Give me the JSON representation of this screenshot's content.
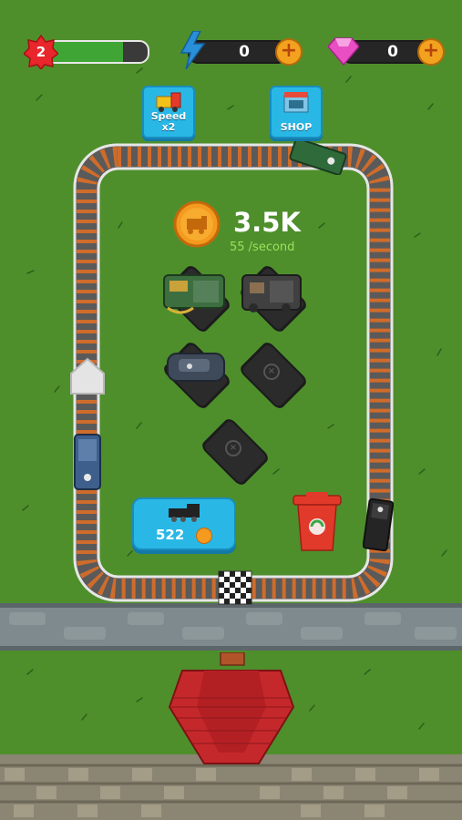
{
  "hud": {
    "level": "2",
    "level_progress": 0.75,
    "energy_value": "0",
    "gems_value": "0",
    "plus_label": "+"
  },
  "buttons": {
    "speed_label": "Speed x2",
    "shop_label": "SHOP"
  },
  "income": {
    "total": "3.5K",
    "rate": "55 /second"
  },
  "buy": {
    "price": "522"
  },
  "colors": {
    "grass": "#4e8f2c",
    "button_blue": "#29b8e6",
    "coin_orange": "#f39a1f",
    "trash_red": "#e23a2a",
    "roof_red": "#c5282b"
  },
  "icons": {
    "level": "star-badge-icon",
    "energy": "lightning-icon",
    "gem": "diamond-icon",
    "speed": "train-icon",
    "shop": "shop-icon",
    "coin": "train-coin-icon",
    "trash": "recycle-bin-icon"
  }
}
